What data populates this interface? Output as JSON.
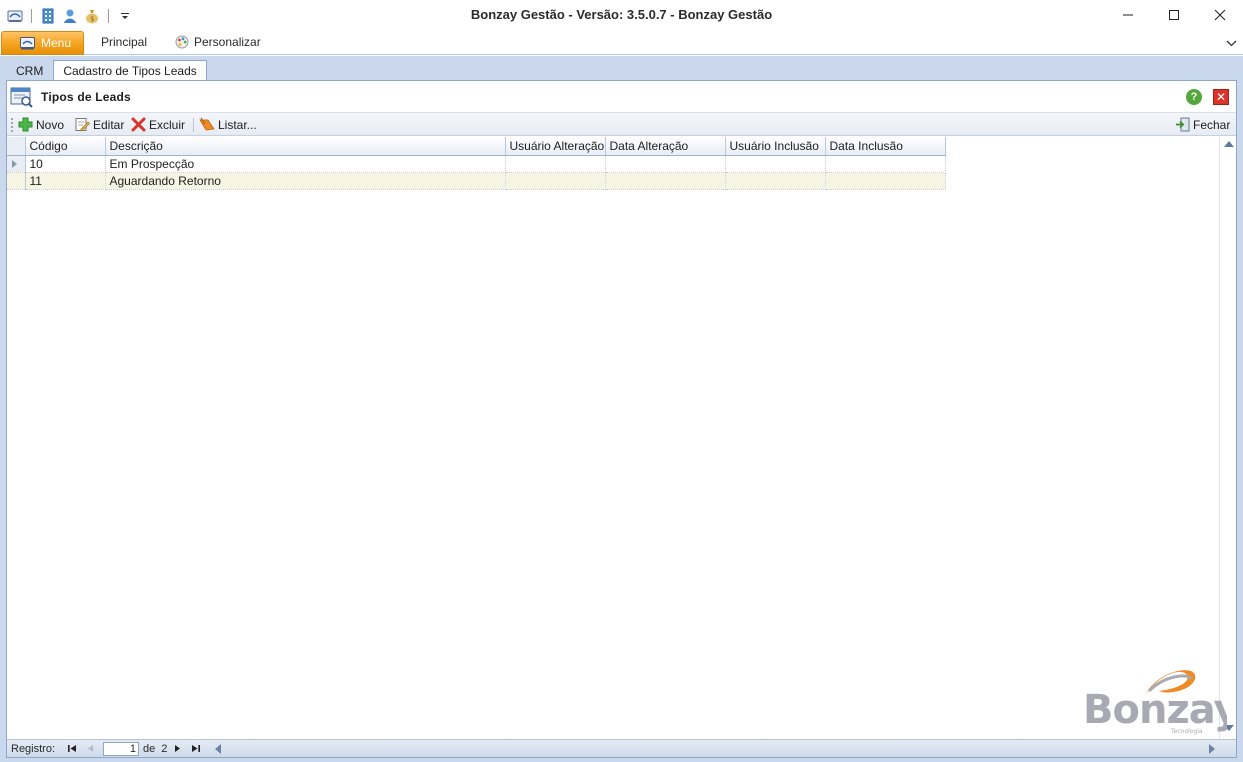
{
  "window": {
    "title": "Bonzay Gestão - Versão: 3.5.0.7 - Bonzay Gestão"
  },
  "ribbon": {
    "menu_label": "Menu",
    "tabs": [
      {
        "label": "Principal"
      },
      {
        "label": "Personalizar"
      }
    ]
  },
  "doc_tabs": [
    {
      "label": "CRM",
      "active": false
    },
    {
      "label": "Cadastro de Tipos Leads",
      "active": true
    }
  ],
  "form": {
    "title": "Tipos de Leads",
    "help_glyph": "?",
    "close_glyph": "✕"
  },
  "toolbar": {
    "novo": "Novo",
    "editar": "Editar",
    "excluir": "Excluir",
    "listar": "Listar...",
    "fechar": "Fechar"
  },
  "grid": {
    "columns": [
      "Código",
      "Descrição",
      "Usuário Alteração",
      "Data Alteração",
      "Usuário Inclusão",
      "Data Inclusão"
    ],
    "rows": [
      {
        "codigo": "10",
        "descricao": "Em Prospecção",
        "usuario_alteracao": "",
        "data_alteracao": "",
        "usuario_inclusao": "",
        "data_inclusao": ""
      },
      {
        "codigo": "11",
        "descricao": "Aguardando Retorno",
        "usuario_alteracao": "",
        "data_alteracao": "",
        "usuario_inclusao": "",
        "data_inclusao": ""
      }
    ]
  },
  "navigator": {
    "label": "Registro:",
    "current": "1",
    "of_label": "de",
    "total": "2"
  },
  "logo": {
    "text": "Bonzay",
    "tagline": "Tecnologia"
  },
  "colors": {
    "menu_orange": "#f4a21f",
    "frame_blue": "#c9d8ec",
    "alt_row": "#f6f4e3",
    "logo_gray": "#a9a9b3",
    "logo_orange": "#f08a24"
  }
}
